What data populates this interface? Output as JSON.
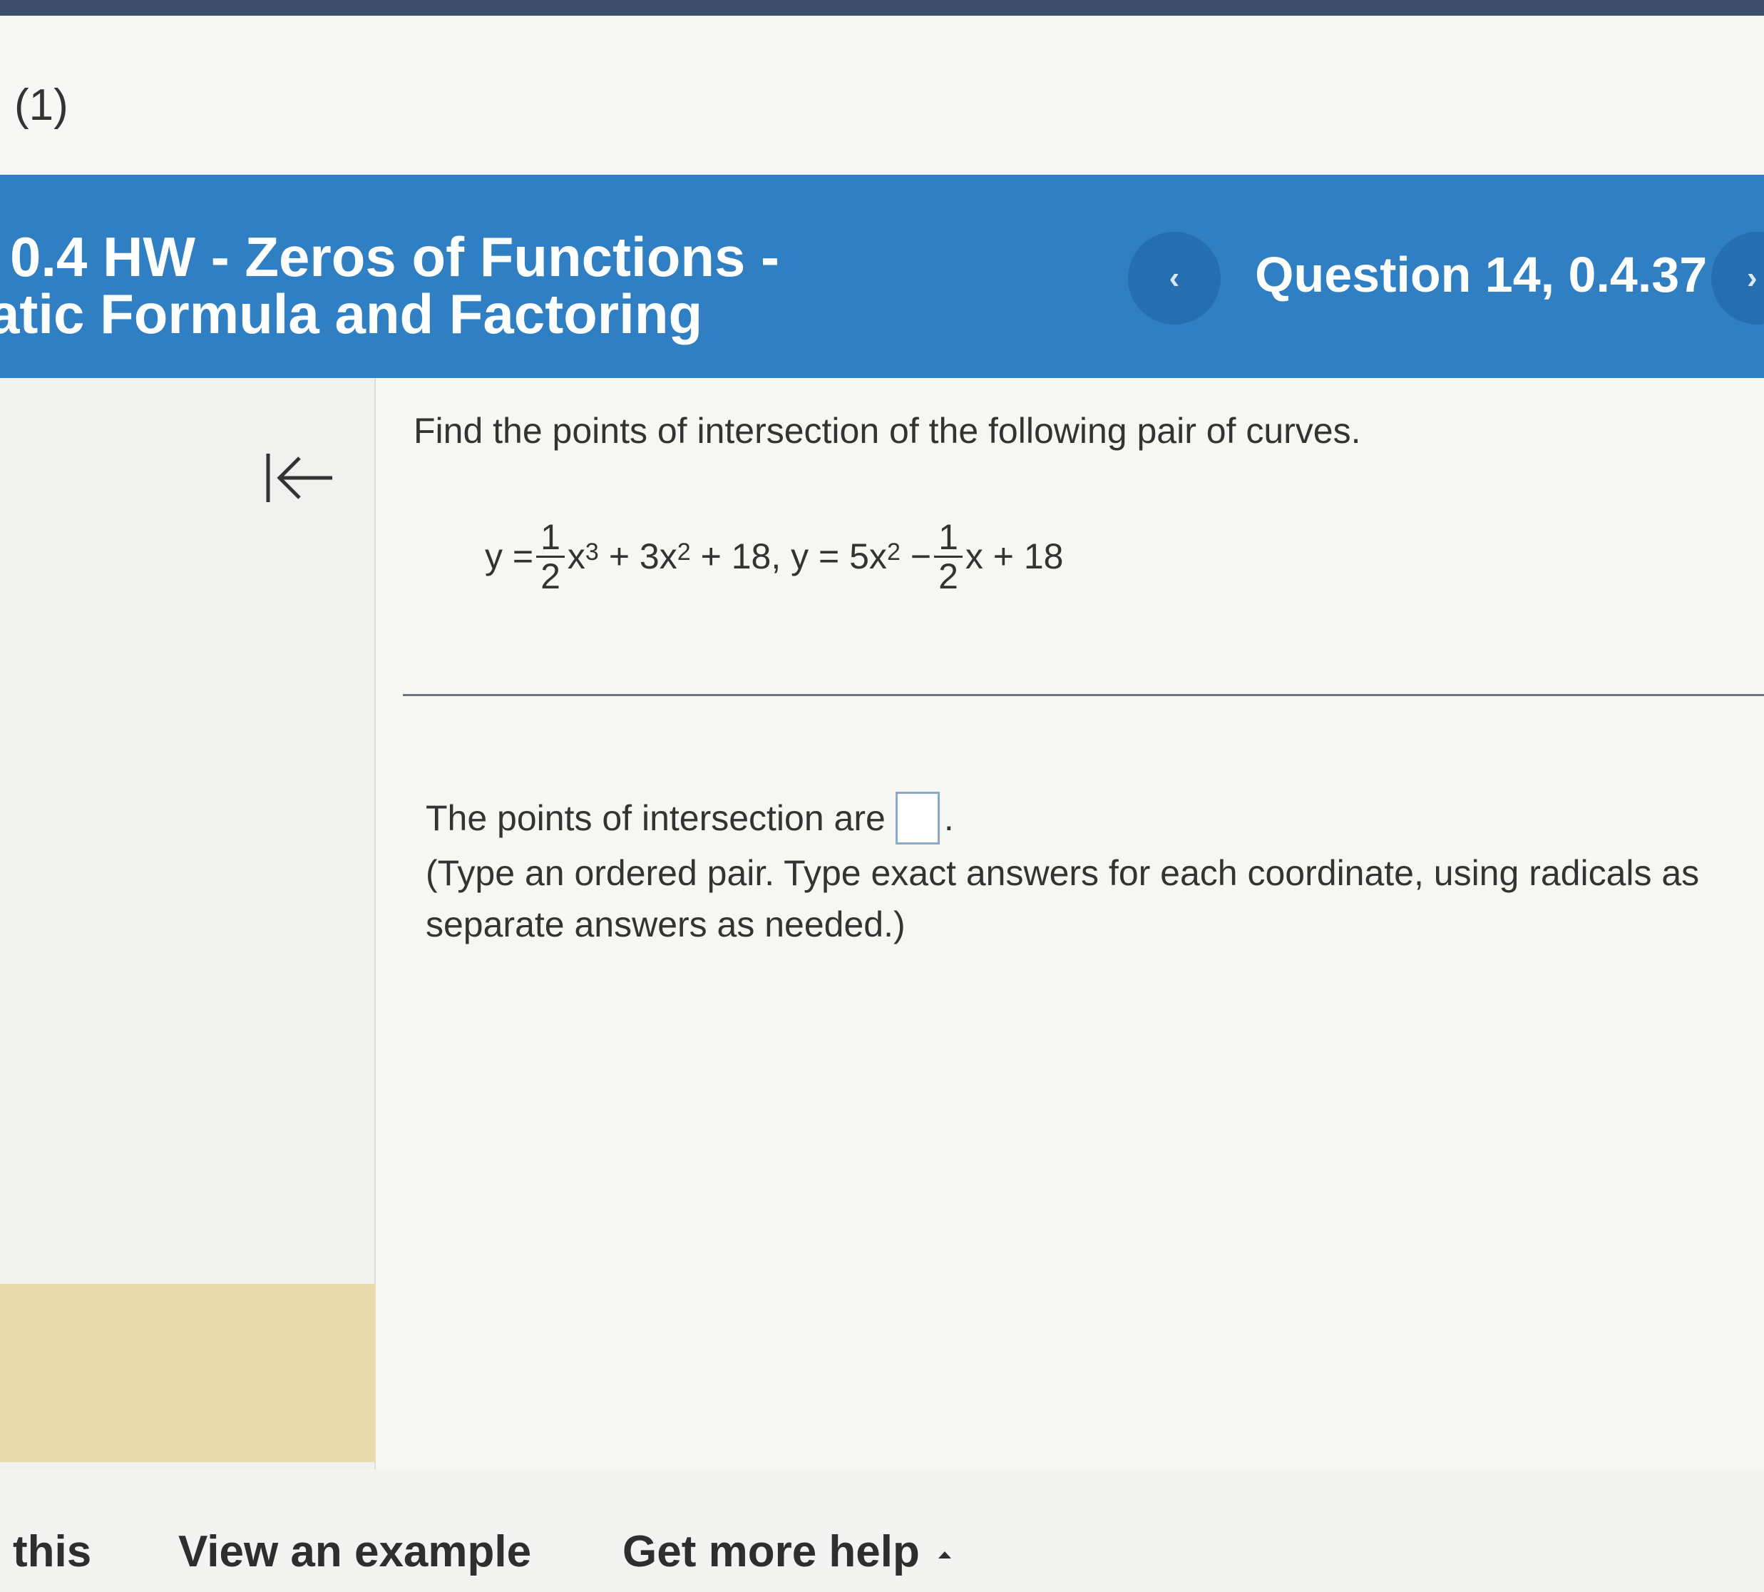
{
  "top": {
    "label": "(1)"
  },
  "header": {
    "title_line1": "0.4 HW - Zeros of Functions -",
    "title_line2": "atic Formula and Factoring",
    "question_label": "Question 14, 0.4.37",
    "prev_icon": "‹",
    "next_icon": "›"
  },
  "sidebar": {
    "collapse_icon": "collapse-left-icon"
  },
  "question": {
    "prompt": "Find the points of intersection of the following pair of curves.",
    "equation": {
      "y_eq_1": "y =",
      "frac1_num": "1",
      "frac1_den": "2",
      "term1_var": "x",
      "term1_exp": "3",
      "term2": "+ 3x",
      "term2_exp": "2",
      "term3": "+ 18, y = 5x",
      "term3_exp": "2",
      "minus": "−",
      "frac2_num": "1",
      "frac2_den": "2",
      "term4": "x + 18"
    }
  },
  "answer": {
    "label": "The points of intersection are",
    "period": ".",
    "instruction_line1": "(Type an ordered pair. Type exact answers for each coordinate, using radicals as",
    "instruction_line2": "separate answers as needed.)"
  },
  "footer": {
    "help_this": "this",
    "view_example": "View an example",
    "get_more_help": "Get more help"
  },
  "colors": {
    "header_bg": "#2f7fc2",
    "nav_button_bg": "#256fb0",
    "answer_box_border": "#8aa9cc"
  }
}
